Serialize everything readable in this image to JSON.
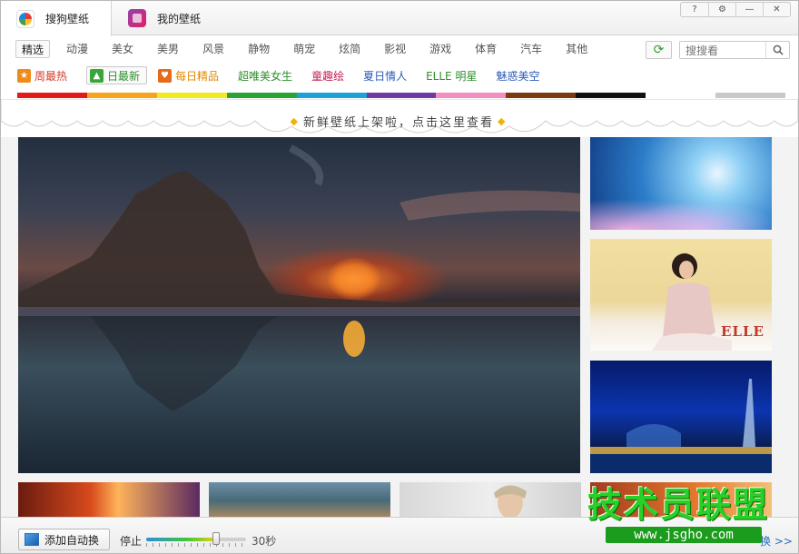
{
  "tabs": [
    {
      "label": "搜狗壁纸",
      "icon": "sogou-logo-icon"
    },
    {
      "label": "我的壁纸",
      "icon": "my-wallpaper-icon"
    }
  ],
  "window_buttons": {
    "help": "?",
    "settings": "⚙",
    "minimize": "—",
    "close": "✕"
  },
  "categories": [
    "精选",
    "动漫",
    "美女",
    "美男",
    "风景",
    "静物",
    "萌宠",
    "炫简",
    "影视",
    "游戏",
    "体育",
    "汽车",
    "其他"
  ],
  "selected_category": "精选",
  "search": {
    "placeholder": "搜搜看"
  },
  "specials": [
    {
      "label": "周最热",
      "color": "#d23b2b",
      "icon": "star-icon"
    },
    {
      "label": "日最新",
      "color": "#2e8f2e",
      "icon": "new-image-icon"
    },
    {
      "label": "每日精品",
      "color": "#e08a00",
      "icon": "heart-icon"
    },
    {
      "label": "超唯美女生",
      "color": "#2e8f2e"
    },
    {
      "label": "童趣绘",
      "color": "#c0205a"
    },
    {
      "label": "夏日情人",
      "color": "#2a5bb8"
    },
    {
      "label": "ELLE 明星",
      "color": "#2e8f2e"
    },
    {
      "label": "魅惑美空",
      "color": "#2a5bb8"
    }
  ],
  "color_filters": [
    "#e41a1a",
    "#f7a41d",
    "#f2ea1e",
    "#2aa336",
    "#1ba3d8",
    "#6e3aa6",
    "#f38ec0",
    "#7b3a10",
    "#111111",
    "#ffffff",
    "#c9c9c9"
  ],
  "banner_text": "新鲜壁纸上架啦，点击这里查看",
  "thumb_text": "ELLE",
  "footer": {
    "auto_button": "添加自动换",
    "stop_label": "停止",
    "interval": "30秒",
    "interval_level": 0.7,
    "next_text": "换 >>"
  },
  "watermark": {
    "title": "技术员联盟",
    "url": "www.jsgho.com"
  }
}
